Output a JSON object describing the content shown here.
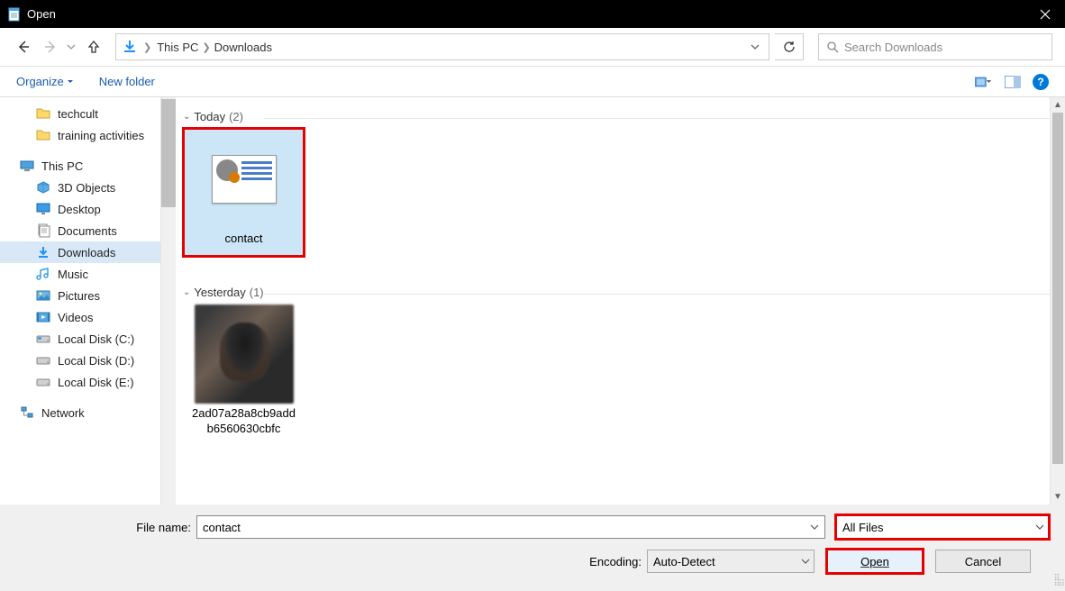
{
  "window": {
    "title": "Open"
  },
  "nav": {
    "breadcrumb": [
      "This PC",
      "Downloads"
    ],
    "search_placeholder": "Search Downloads"
  },
  "toolbar": {
    "organize": "Organize",
    "new_folder": "New folder"
  },
  "sidebar": {
    "folders": [
      {
        "label": "techcult",
        "icon": "folder"
      },
      {
        "label": "training activities",
        "icon": "folder"
      }
    ],
    "this_pc_label": "This PC",
    "this_pc_items": [
      {
        "label": "3D Objects",
        "icon": "3d"
      },
      {
        "label": "Desktop",
        "icon": "desktop"
      },
      {
        "label": "Documents",
        "icon": "documents"
      },
      {
        "label": "Downloads",
        "icon": "downloads",
        "selected": true
      },
      {
        "label": "Music",
        "icon": "music"
      },
      {
        "label": "Pictures",
        "icon": "pictures"
      },
      {
        "label": "Videos",
        "icon": "videos"
      },
      {
        "label": "Local Disk (C:)",
        "icon": "disk-c"
      },
      {
        "label": "Local Disk (D:)",
        "icon": "disk"
      },
      {
        "label": "Local Disk (E:)",
        "icon": "disk"
      }
    ],
    "network_label": "Network"
  },
  "groups": [
    {
      "title": "Today",
      "count": "(2)",
      "items": [
        {
          "name": "contact",
          "type": "contact",
          "selected": true,
          "highlight": true
        }
      ]
    },
    {
      "title": "Yesterday",
      "count": "(1)",
      "items": [
        {
          "name": "2ad07a28a8cb9addb6560630cbfc",
          "type": "image",
          "selected": false
        }
      ]
    }
  ],
  "footer": {
    "filename_label": "File name:",
    "filename_value": "contact",
    "filetype_value": "All Files",
    "encoding_label": "Encoding:",
    "encoding_value": "Auto-Detect",
    "open_label": "Open",
    "cancel_label": "Cancel"
  }
}
